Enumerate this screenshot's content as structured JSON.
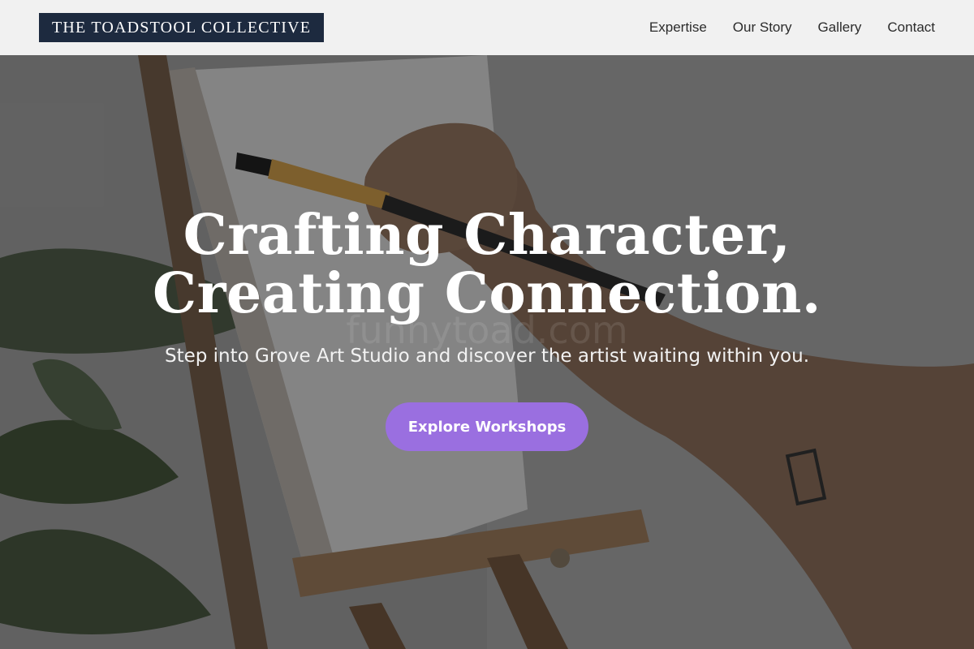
{
  "header": {
    "brand": "THE TOADSTOOL COLLECTIVE",
    "nav": [
      {
        "label": "Expertise"
      },
      {
        "label": "Our Story"
      },
      {
        "label": "Gallery"
      },
      {
        "label": "Contact"
      }
    ]
  },
  "hero": {
    "headline_line1": "Crafting Character,",
    "headline_line2": "Creating Connection.",
    "subheadline": "Step into Grove Art Studio and discover the artist waiting within you.",
    "cta_label": "Explore Workshops",
    "watermark": "funnytoad.com"
  },
  "colors": {
    "brand_bg": "#1d2a3f",
    "cta_bg": "#9a6fe0",
    "header_bg": "#f1f1f1"
  }
}
